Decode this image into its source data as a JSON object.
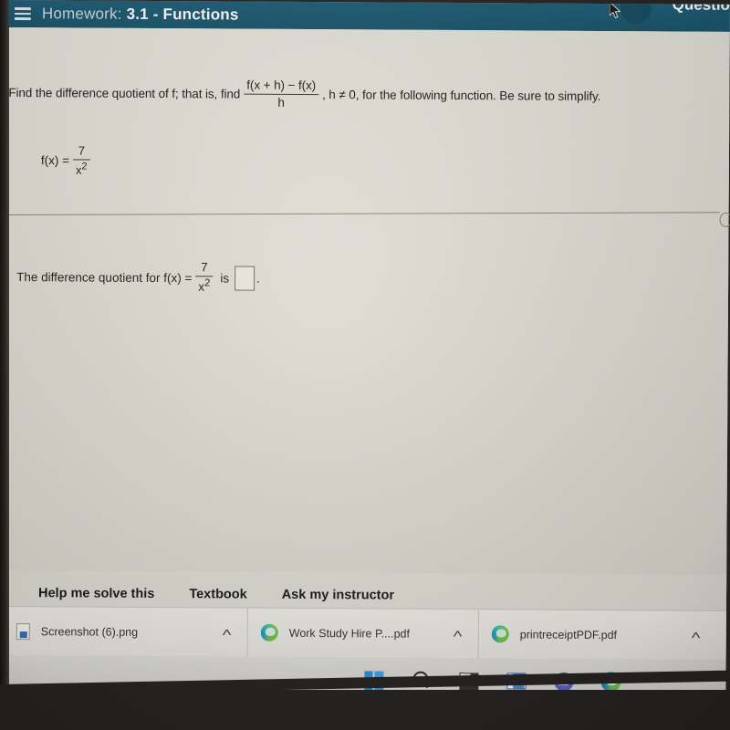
{
  "app_header": {
    "menu_icon": "hamburger-menu-icon",
    "title_prefix": "Homework:",
    "title_main": "3.1 - Functions",
    "right_label": "Questio",
    "cursor_icon": "mouse-pointer-icon",
    "bg_color": "#1d5a72"
  },
  "question": {
    "prompt_part1": "Find the difference quotient of f; that is, find",
    "fraction_numerator": "f(x + h) − f(x)",
    "fraction_denominator": "h",
    "prompt_part2": ", h ≠ 0, for the following function. Be sure to simplify.",
    "function_label": "f(x) =",
    "function_numerator": "7",
    "function_denominator": "x",
    "function_exponent": "2"
  },
  "answer": {
    "prefix": "The difference quotient for f(x) =",
    "numerator": "7",
    "denominator": "x",
    "exponent": "2",
    "is_word": "is",
    "input_value": "",
    "period": "."
  },
  "actions": {
    "help": "Help me solve this",
    "textbook": "Textbook",
    "instructor": "Ask my instructor"
  },
  "downloads": [
    {
      "name": "Screenshot (6).png",
      "icon": "image-file-icon",
      "chevron": "˄"
    },
    {
      "name": "Work Study Hire P....pdf",
      "icon": "edge-browser-icon",
      "chevron": "˄"
    },
    {
      "name": "printreceiptPDF.pdf",
      "icon": "edge-browser-icon",
      "chevron": "˄"
    }
  ],
  "taskbar": [
    {
      "name": "start-button"
    },
    {
      "name": "search-button"
    },
    {
      "name": "task-view-button"
    },
    {
      "name": "widgets-button"
    },
    {
      "name": "teams-chat-button"
    },
    {
      "name": "edge-browser-button"
    }
  ]
}
